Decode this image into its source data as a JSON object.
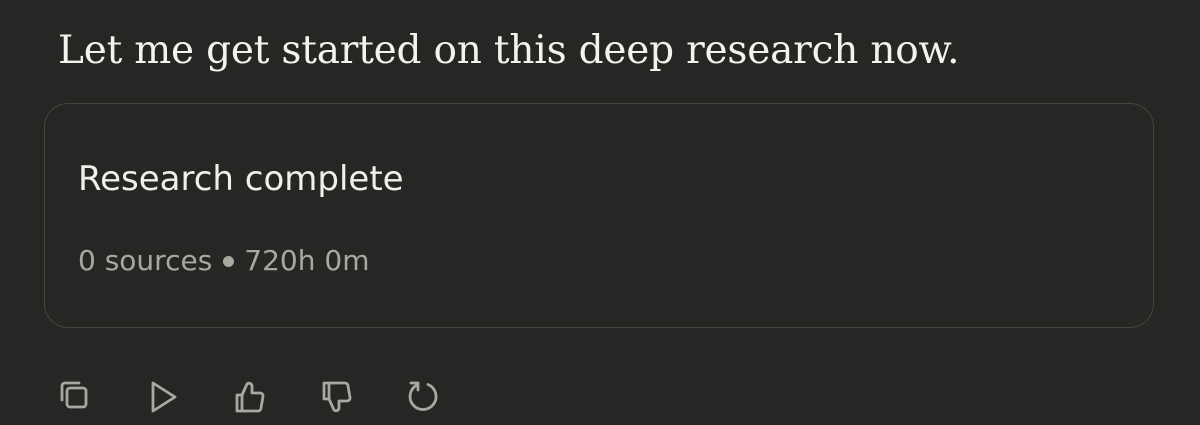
{
  "message": {
    "text": "Let me get started on this deep research now."
  },
  "research_card": {
    "title": "Research complete",
    "sources": "0 sources",
    "duration": "720h 0m"
  },
  "actions": [
    {
      "name": "copy",
      "icon": "copy-icon"
    },
    {
      "name": "read-aloud",
      "icon": "play-icon"
    },
    {
      "name": "thumbs-up",
      "icon": "thumbs-up-icon"
    },
    {
      "name": "thumbs-down",
      "icon": "thumbs-down-icon"
    },
    {
      "name": "retry",
      "icon": "retry-icon"
    }
  ],
  "colors": {
    "background": "#262624",
    "text_primary": "#f4f2ec",
    "text_secondary": "#a9a79f",
    "card_border": "#46453f"
  }
}
